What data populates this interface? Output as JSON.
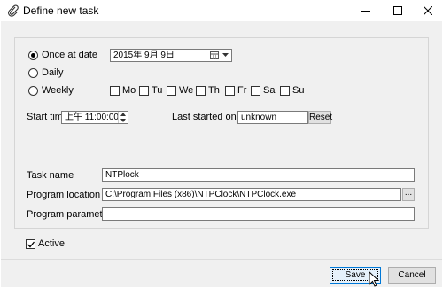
{
  "window": {
    "title": "Define new task"
  },
  "schedule": {
    "once_label": "Once at date",
    "daily_label": "Daily",
    "weekly_label": "Weekly",
    "date_value": "2015年  9月  9日",
    "days": [
      "Mo",
      "Tu",
      "We",
      "Th",
      "Fr",
      "Sa",
      "Su"
    ],
    "start_time_label": "Start time",
    "start_time_value": "上午 11:00:00",
    "last_started_label": "Last started on",
    "last_started_value": "unknown",
    "reset_label": "Reset",
    "selected": "once"
  },
  "program": {
    "task_name_label": "Task name",
    "task_name_value": "NTPlock",
    "location_label": "Program location",
    "location_value": "C:\\Program Files (x86)\\NTPClock\\NTPClock.exe",
    "browse_label": "...",
    "parameters_label": "Program parameters",
    "parameters_value": ""
  },
  "active": {
    "label": "Active",
    "checked": true
  },
  "footer": {
    "save_label": "Save",
    "cancel_label": "Cancel"
  }
}
